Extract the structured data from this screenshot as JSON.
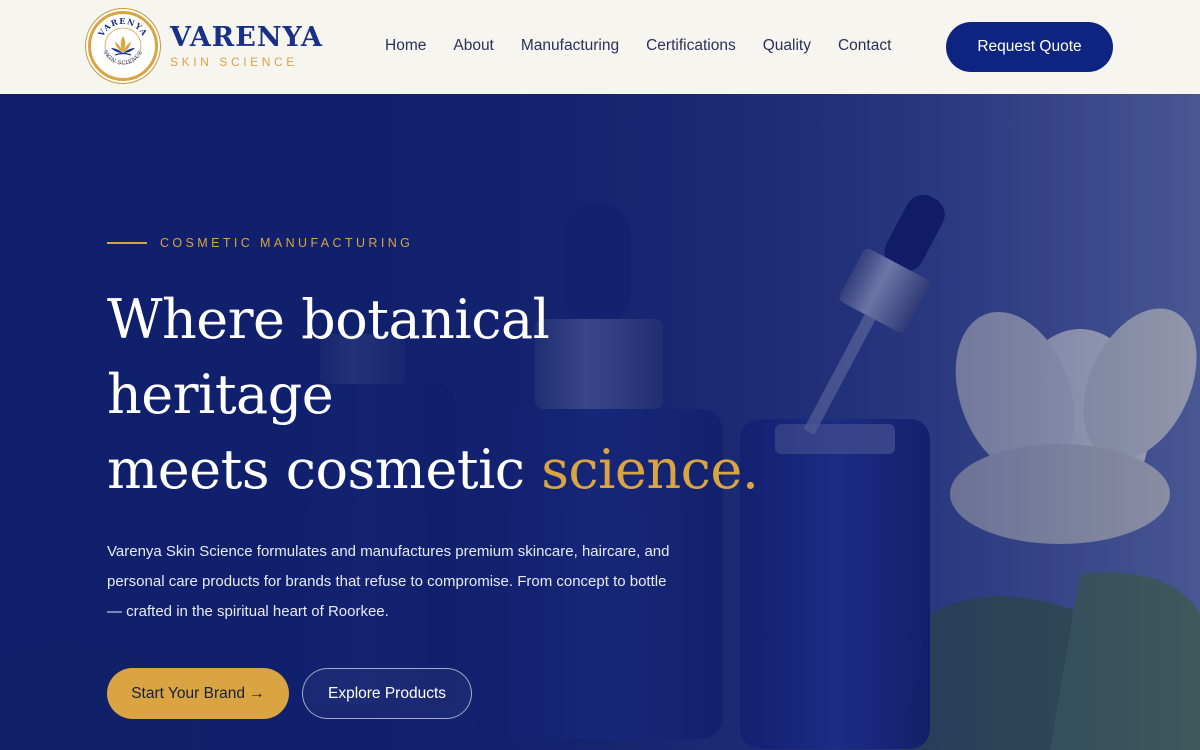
{
  "brand": {
    "seal_text_top": "VARENYA",
    "seal_text_bottom": "SKIN SCIENCE",
    "name": "VARENYA",
    "tagline": "SKIN SCIENCE"
  },
  "nav": {
    "items": [
      {
        "label": "Home"
      },
      {
        "label": "About"
      },
      {
        "label": "Manufacturing"
      },
      {
        "label": "Certifications"
      },
      {
        "label": "Quality"
      },
      {
        "label": "Contact"
      }
    ],
    "cta_label": "Request Quote"
  },
  "hero": {
    "eyebrow": "COSMETIC MANUFACTURING",
    "headline_line1": "Where botanical",
    "headline_line2": "heritage",
    "headline_line3_prefix": "meets cosmetic ",
    "headline_accent": "science.",
    "description": "Varenya Skin Science formulates and manufactures premium skincare, haircare, and personal care products for brands that refuse to compromise. From concept to bottle — crafted in the spiritual heart of Roorkee.",
    "primary_button": "Start Your Brand →",
    "secondary_button": "Explore Products"
  },
  "colors": {
    "navy": "#0d2580",
    "gold": "#d9a441",
    "header_bg": "#f7f5f0",
    "hero_overlay": "#0f1f6b"
  }
}
